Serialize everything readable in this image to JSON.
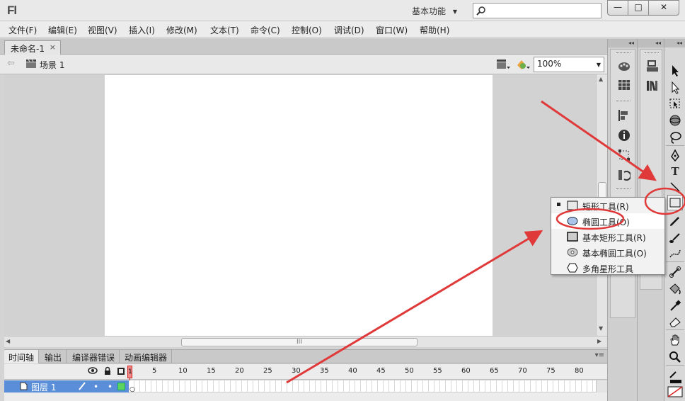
{
  "app": {
    "logo": "Fl",
    "workspace": "基本功能",
    "search_placeholder": "",
    "window": {
      "minimize": "—",
      "maximize": "□",
      "close": "✕"
    }
  },
  "menu": {
    "items": [
      "文件(F)",
      "编辑(E)",
      "视图(V)",
      "插入(I)",
      "修改(M)",
      "文本(T)",
      "命令(C)",
      "控制(O)",
      "调试(D)",
      "窗口(W)",
      "帮助(H)"
    ]
  },
  "document": {
    "tab_title": "未命名-1",
    "tab_close": "×",
    "scene_label": "场景 1",
    "zoom": "100%",
    "scroll_grip": "III"
  },
  "timeline": {
    "tabs": [
      "时间轴",
      "输出",
      "编译器错误",
      "动画编辑器"
    ],
    "frame_numbers": [
      "1",
      "5",
      "10",
      "15",
      "20",
      "25",
      "30",
      "35",
      "40",
      "45",
      "50",
      "55",
      "60",
      "65",
      "70",
      "75",
      "80"
    ],
    "current_frame": "1",
    "layer": {
      "name": "图层 1",
      "dot": "•"
    },
    "panel_menu": "▾≡"
  },
  "flyout": {
    "items": [
      {
        "label": "矩形工具(R)",
        "icon": "rectangle-icon",
        "selected": true
      },
      {
        "label": "椭圆工具(O)",
        "icon": "oval-icon",
        "highlighted": true
      },
      {
        "label": "基本矩形工具(R)",
        "icon": "primitive-rectangle-icon"
      },
      {
        "label": "基本椭圆工具(O)",
        "icon": "primitive-oval-icon"
      },
      {
        "label": "多角星形工具",
        "icon": "polystar-icon"
      }
    ]
  },
  "colors": {
    "annotation_red": "#e0393a",
    "layer_selected": "#5a8ed8",
    "stage": "#ffffff",
    "playhead": "#cc2222"
  },
  "tools": [
    "selection-icon",
    "subselection-icon",
    "free-transform-icon",
    "3d-rotation-icon",
    "lasso-icon",
    "pen-icon",
    "text-icon",
    "line-icon",
    "rectangle-icon",
    "pencil-icon",
    "brush-icon",
    "deco-icon",
    "bone-icon",
    "paint-bucket-icon",
    "eyedropper-icon",
    "eraser-icon",
    "hand-icon",
    "zoom-icon",
    "stroke-color-icon",
    "fill-color-icon"
  ],
  "tool_text": {
    "text_tool": "T"
  }
}
